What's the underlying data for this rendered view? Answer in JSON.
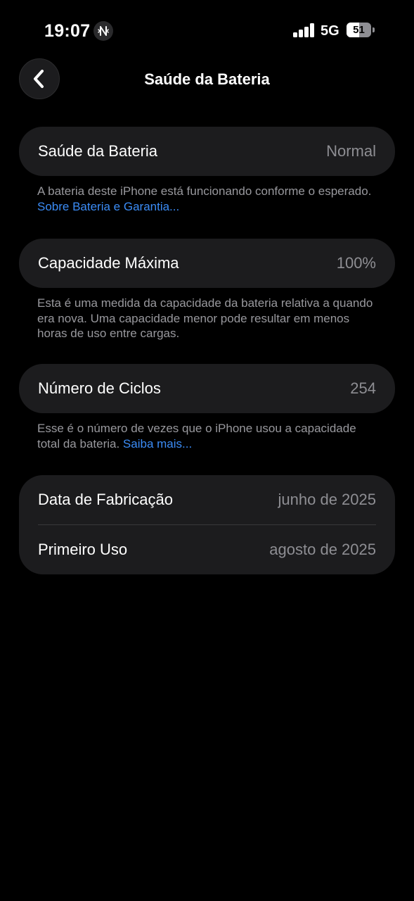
{
  "status_bar": {
    "time": "19:07",
    "network": "5G",
    "battery_level": "51",
    "battery_fraction": 0.51,
    "signal_bars": 4,
    "icons": [
      "focus-mode-icon",
      "signal-icon",
      "battery-icon"
    ]
  },
  "nav": {
    "title": "Saúde da Bateria",
    "back_icon": "chevron-left-icon"
  },
  "sections": {
    "health": {
      "label": "Saúde da Bateria",
      "value": "Normal",
      "footnote": "A bateria deste iPhone está funcionando conforme o esperado. ",
      "link": "Sobre Bateria e Garantia..."
    },
    "capacity": {
      "label": "Capacidade Máxima",
      "value": "100%",
      "footnote": "Esta é uma medida da capacidade da bateria relativa a quando era nova. Uma capacidade menor pode resultar em menos horas de uso entre cargas."
    },
    "cycles": {
      "label": "Número de Ciclos",
      "value": "254",
      "footnote": "Esse é o número de vezes que o iPhone usou a capacidade total da bateria. ",
      "link": "Saiba mais..."
    },
    "dates": {
      "manufacture_label": "Data de Fabricação",
      "manufacture_value": "junho de 2025",
      "first_use_label": "Primeiro Uso",
      "first_use_value": "agosto de 2025"
    }
  },
  "colors": {
    "background": "#000000",
    "card": "#1c1c1e",
    "secondary_text": "#8e8e93",
    "link": "#3b8cf6"
  }
}
